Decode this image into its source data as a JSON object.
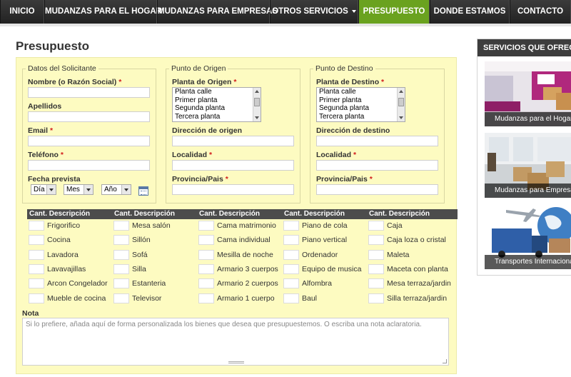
{
  "nav": {
    "items": [
      {
        "label": "INICIO"
      },
      {
        "label": "MUDANZAS PARA EL HOGAR"
      },
      {
        "label": "MUDANZAS PARA EMPRESAS"
      },
      {
        "label": "OTROS SERVICIOS"
      },
      {
        "label": "PRESUPUESTO"
      },
      {
        "label": "DONDE ESTAMOS"
      },
      {
        "label": "CONTACTO"
      }
    ],
    "active_color": "#6aa21f"
  },
  "page_title": "Presupuesto",
  "solicitante": {
    "legend": "Datos del Solicitante",
    "nombre_label": "Nombre (o Razón Social)",
    "apellidos_label": "Apellidos",
    "email_label": "Email",
    "telefono_label": "Teléfono",
    "fecha_label": "Fecha prevista",
    "dia": "Día",
    "mes": "Mes",
    "ano": "Año",
    "required_mark": "*"
  },
  "origen": {
    "legend": "Punto de Origen",
    "planta_label": "Planta de Origen",
    "options": [
      "Planta calle",
      "Primer planta",
      "Segunda planta",
      "Tercera planta"
    ],
    "direccion_label": "Dirección de origen",
    "localidad_label": "Localidad",
    "provincia_label": "Provincia/Pais"
  },
  "destino": {
    "legend": "Punto de Destino",
    "planta_label": "Planta de Destino",
    "options": [
      "Planta calle",
      "Primer planta",
      "Segunda planta",
      "Tercera planta"
    ],
    "direccion_label": "Dirección de destino",
    "localidad_label": "Localidad",
    "provincia_label": "Provincia/Pais"
  },
  "grid": {
    "header": "Cant. Descripción",
    "columns": [
      [
        "Frigorifico",
        "Cocina",
        "Lavadora",
        "Lavavajillas",
        "Arcon Congelador",
        "Mueble de cocina"
      ],
      [
        "Mesa salón",
        "Sillón",
        "Sofá",
        "Silla",
        "Estanteria",
        "Televisor"
      ],
      [
        "Cama matrimonio",
        "Cama individual",
        "Mesilla de noche",
        "Armario 3 cuerpos",
        "Armario 2 cuerpos",
        "Armario 1 cuerpo"
      ],
      [
        "Piano de cola",
        "Piano vertical",
        "Ordenador",
        "Equipo de musica",
        "Alfombra",
        "Baul"
      ],
      [
        "Caja",
        "Caja loza o cristal",
        "Maleta",
        "Maceta con planta",
        "Mesa terraza/jardin",
        "Silla terraza/jardin"
      ]
    ]
  },
  "nota": {
    "label": "Nota",
    "placeholder": "Si lo prefiere, añada aquí de forma personalizada los bienes que desea que presupuestemos. O escriba una nota aclaratoria."
  },
  "sidebar": {
    "title": "SERVICIOS QUE OFRECEMOS",
    "cards": [
      {
        "caption": "Mudanzas para el Hogar"
      },
      {
        "caption": "Mudanzas para Empresas"
      },
      {
        "caption": "Transportes Internacionales"
      }
    ]
  }
}
